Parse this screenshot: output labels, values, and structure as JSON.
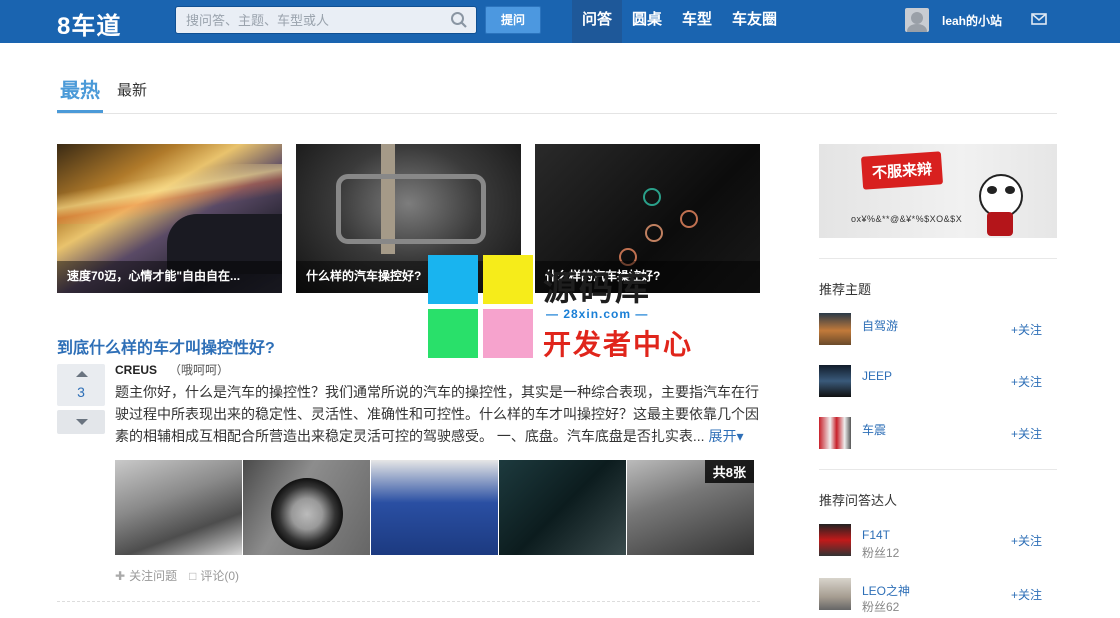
{
  "header": {
    "logo": "8车道",
    "search_placeholder": "搜问答、主题、车型或人",
    "ask_button": "提问",
    "nav": [
      "问答",
      "圆桌",
      "车型",
      "车友圈"
    ],
    "user_name": "leah的小站",
    "brand_color": "#1a64b0"
  },
  "tabs": {
    "hot": "最热",
    "new": "最新"
  },
  "featured": [
    {
      "caption": "速度70迈，心情才能\"自由自在..."
    },
    {
      "caption": "什么样的汽车操控好?"
    },
    {
      "caption": "什么样的汽车操控好?"
    }
  ],
  "question": {
    "title": "到底什么样的车才叫操控性好?",
    "votes": "3",
    "author_name": "CREUS",
    "author_note": "（哦呵呵）",
    "answer": "题主你好，什么是汽车的操控性？我们通常所说的汽车的操控性，其实是一种综合表现，主要指汽车在行驶过程中所表现出来的稳定性、灵活性、准确性和可控性。什么样的车才叫操控好？这最主要依靠几个因素的相辅相成互相配合所营造出来稳定灵活可控的驾驶感受。 一、底盘。汽车底盘是否扎实表...",
    "expand_label": "展开",
    "image_total": "共8张",
    "follow_label": "关注问题",
    "comment_label": "评论(0)"
  },
  "sidebar": {
    "ad_tag": "不服来辩",
    "ad_sub": "ox¥%&**@&¥*%$XO&$X",
    "topics_title": "推荐主题",
    "topics": [
      {
        "name": "自驾游",
        "follow": "关注"
      },
      {
        "name": "JEEP",
        "follow": "关注"
      },
      {
        "name": "车震",
        "follow": "关注"
      }
    ],
    "experts_title": "推荐问答达人",
    "experts": [
      {
        "name": "F14T",
        "fans": "粉丝12",
        "follow": "关注"
      },
      {
        "name": "LEO之神",
        "fans": "粉丝62",
        "follow": "关注"
      }
    ]
  },
  "watermark": {
    "brand": "源码库",
    "url": "— 28xin.com —",
    "dev": "开发者中心",
    "colors": [
      "#19b4ef",
      "#f6ec1a",
      "#29e06a",
      "#f6a3cd"
    ]
  }
}
